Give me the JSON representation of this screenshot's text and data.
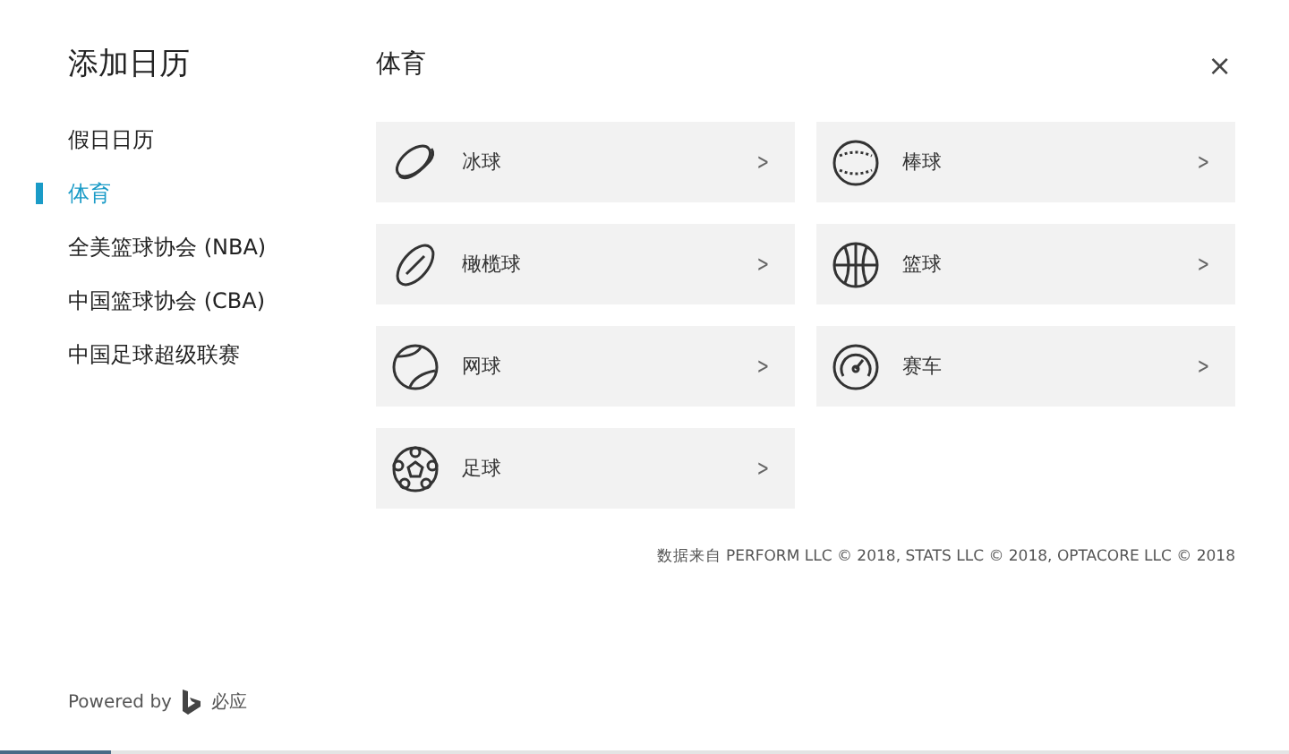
{
  "sidebar": {
    "title": "添加日历",
    "items": [
      {
        "label": "假日日历",
        "selected": false
      },
      {
        "label": "体育",
        "selected": true
      },
      {
        "label": "全美篮球协会 (NBA)",
        "selected": false
      },
      {
        "label": "中国篮球协会 (CBA)",
        "selected": false
      },
      {
        "label": "中国足球超级联赛",
        "selected": false
      }
    ],
    "powered_by": {
      "label": "Powered by",
      "brand": "必应"
    }
  },
  "main": {
    "title": "体育",
    "close": "×",
    "tiles": [
      {
        "label": "冰球",
        "kind": "puck",
        "chevron": ">"
      },
      {
        "label": "棒球",
        "kind": "baseball",
        "chevron": ">"
      },
      {
        "label": "橄榄球",
        "kind": "rugby",
        "chevron": ">"
      },
      {
        "label": "篮球",
        "kind": "basketball",
        "chevron": ">"
      },
      {
        "label": "网球",
        "kind": "tennis",
        "chevron": ">"
      },
      {
        "label": "赛车",
        "kind": "gauge",
        "chevron": ">"
      },
      {
        "label": "足球",
        "kind": "soccer",
        "chevron": ">"
      }
    ],
    "credit": "数据来自 PERFORM LLC © 2018, STATS LLC © 2018, OPTACORE LLC © 2018"
  },
  "progress": {
    "level": 0.086
  }
}
